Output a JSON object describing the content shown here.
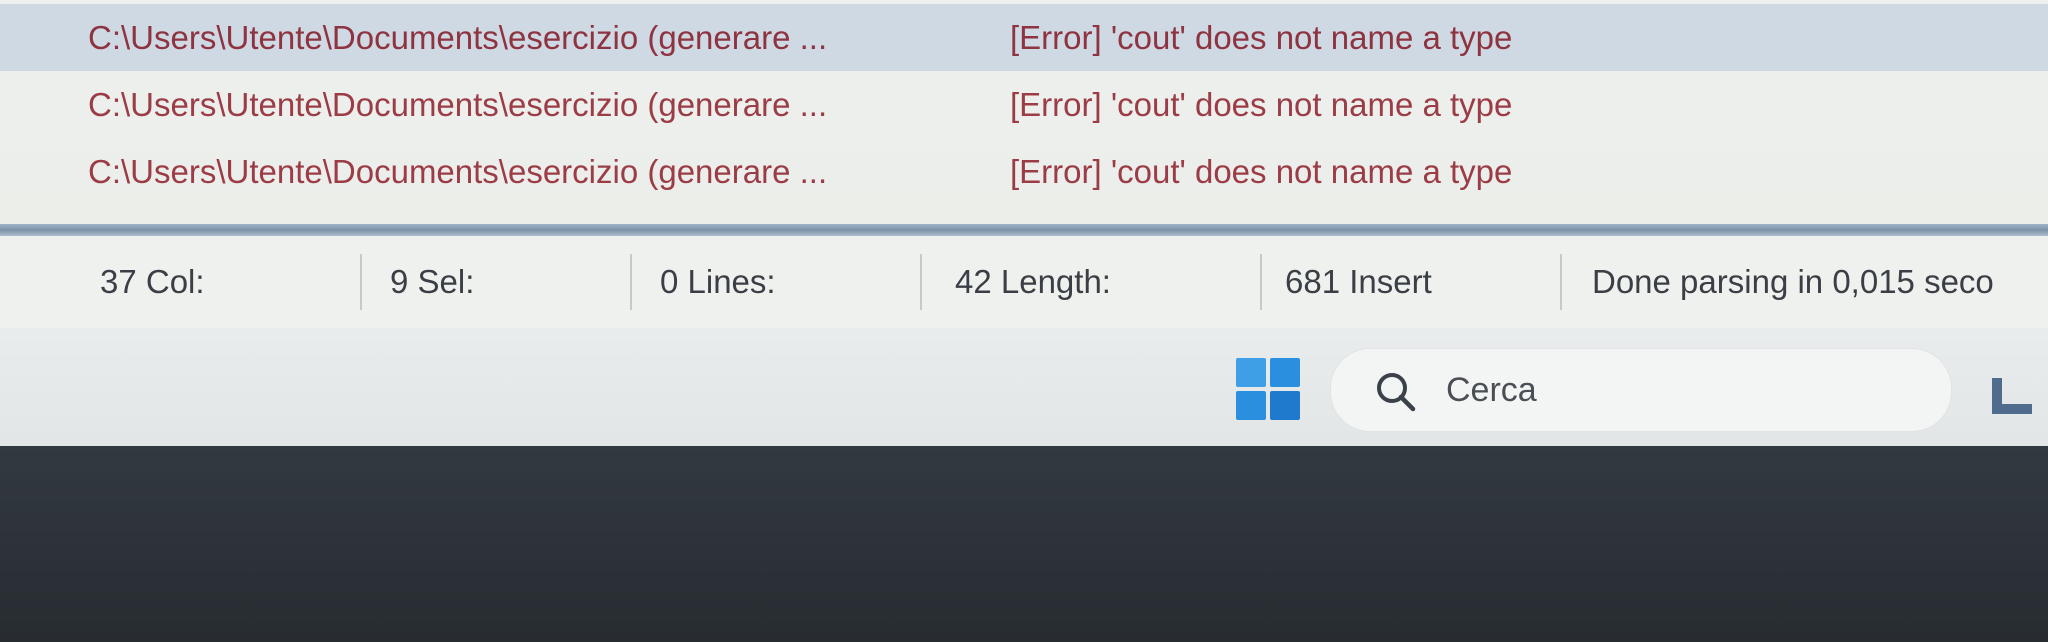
{
  "messages": [
    {
      "file": "C:\\Users\\Utente\\Documents\\esercizio (generare ...",
      "message": "[Error] 'cout' does not name a type"
    },
    {
      "file": "C:\\Users\\Utente\\Documents\\esercizio (generare ...",
      "message": "[Error] 'cout' does not name a type"
    },
    {
      "file": "C:\\Users\\Utente\\Documents\\esercizio (generare ...",
      "message": "[Error] 'cout' does not name a type"
    }
  ],
  "statusbar": {
    "col": "37 Col:",
    "sel": "9 Sel:",
    "lines": "0 Lines:",
    "length": "42 Length:",
    "insert": "681  Insert",
    "parse": "Done parsing in 0,015 seco"
  },
  "taskbar": {
    "search_placeholder": "Cerca",
    "start_icon": "windows-start-icon",
    "search_icon": "search-icon",
    "tray_icon": "app-tray-icon"
  },
  "colors": {
    "error_text": "#9b3c46",
    "selected_row": "#cfd9e4",
    "windows_blue": "#2b8fe0"
  }
}
